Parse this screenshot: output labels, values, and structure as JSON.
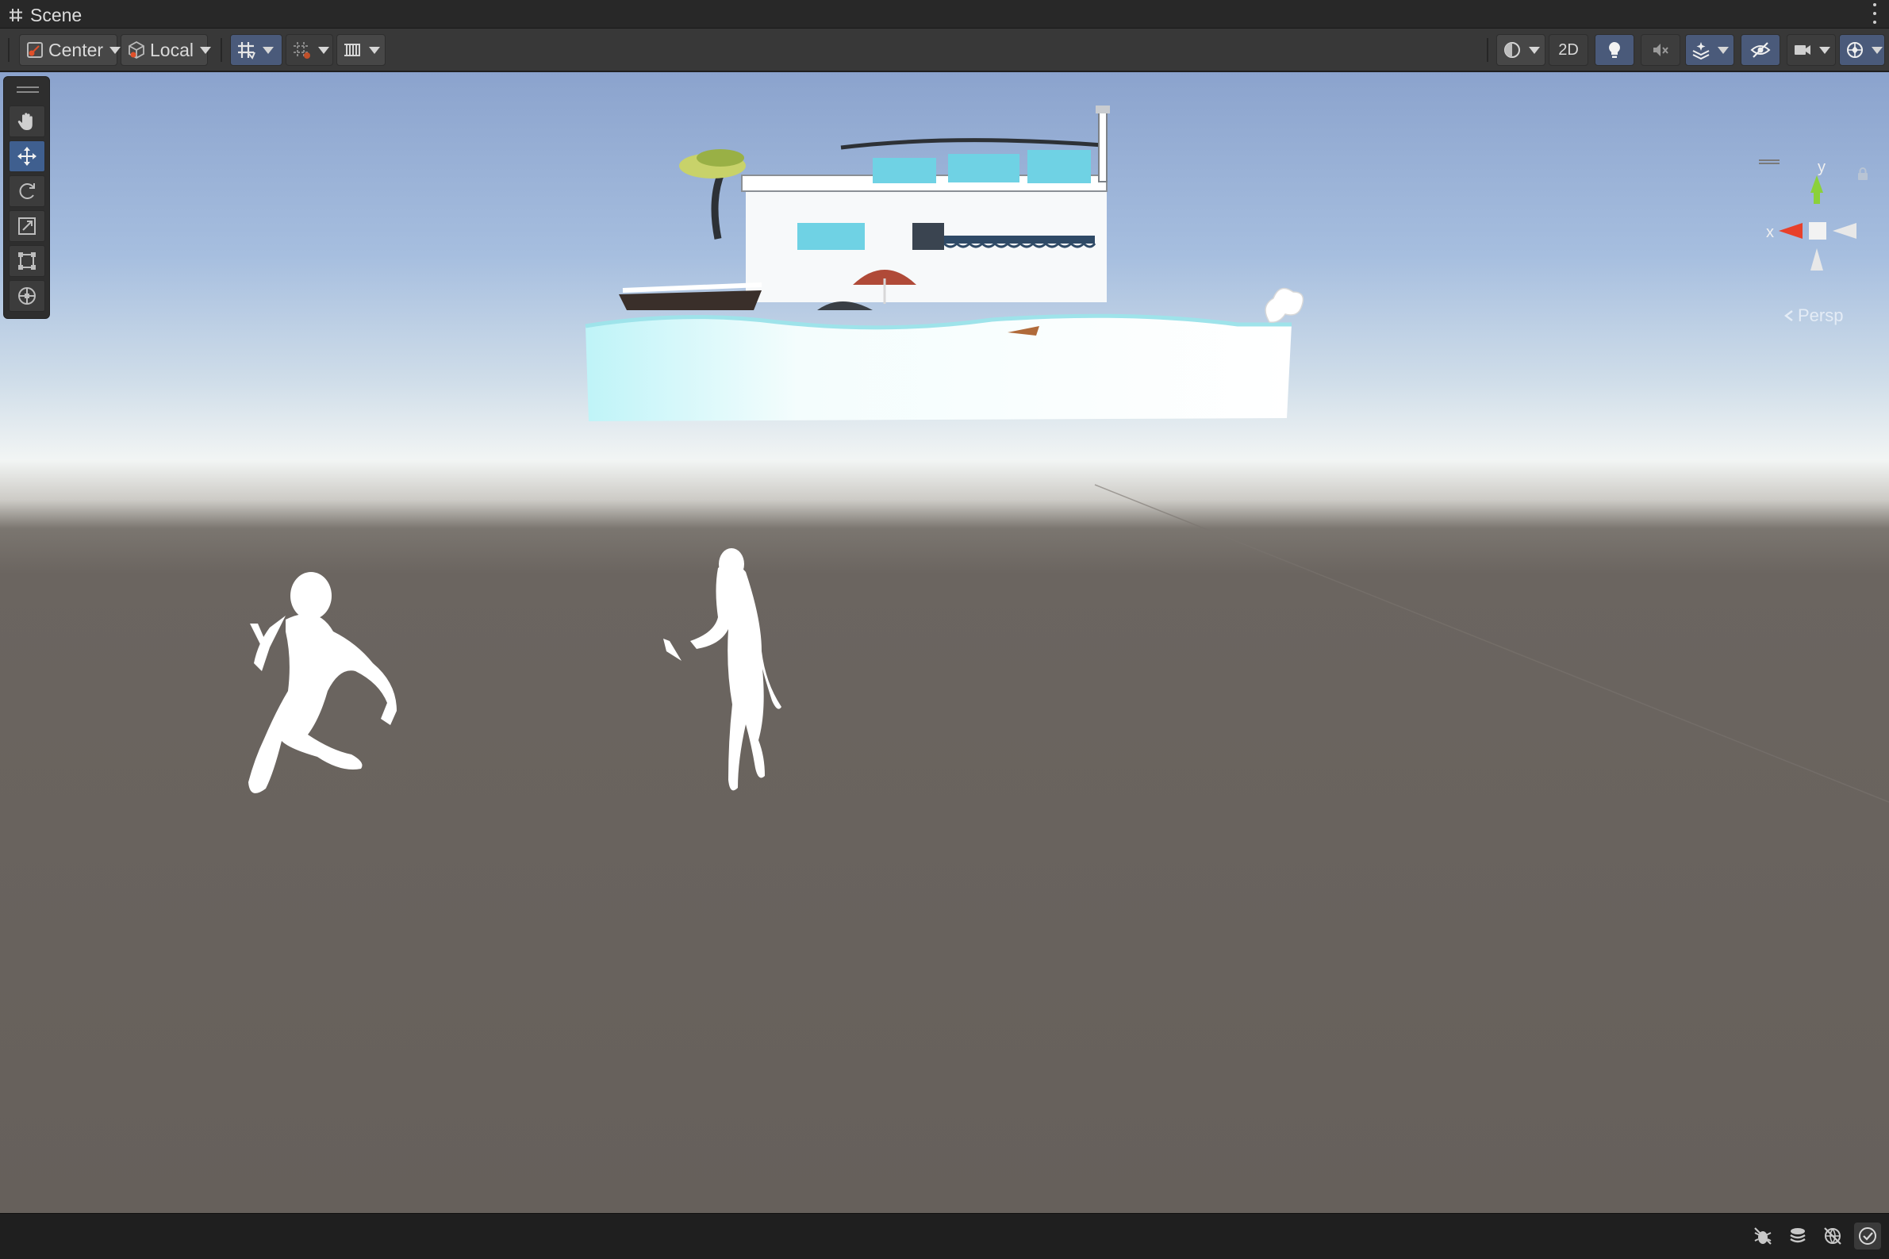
{
  "window": {
    "tab_title": "Scene",
    "tab_icon": "grid-hash-icon",
    "menu_icon": "kebab-menu-icon"
  },
  "toolbar": {
    "pivot_mode": "Center",
    "pivot_space": "Local",
    "view_2d_label": "2D",
    "left_group": [
      {
        "name": "pivot-mode-dropdown",
        "icon": "pivot-icon"
      },
      {
        "name": "pivot-space-dropdown",
        "icon": "local-cube-icon"
      },
      {
        "name": "grid-snap-toggle",
        "icon": "grid-snap-icon"
      },
      {
        "name": "increment-snap-toggle",
        "icon": "increment-snap-icon"
      },
      {
        "name": "vertex-snap-toggle",
        "icon": "ruler-grid-icon"
      }
    ],
    "right_group": [
      {
        "name": "draw-mode-dropdown",
        "icon": "shading-sphere-icon"
      },
      {
        "name": "2d-toggle",
        "icon": "2d-label"
      },
      {
        "name": "lighting-toggle",
        "icon": "lightbulb-icon"
      },
      {
        "name": "audio-toggle",
        "icon": "speaker-muted-icon"
      },
      {
        "name": "effects-dropdown",
        "icon": "layers-sparkle-icon"
      },
      {
        "name": "hidden-objects-toggle",
        "icon": "eye-slash-icon"
      },
      {
        "name": "camera-dropdown",
        "icon": "camera-icon"
      },
      {
        "name": "gizmos-dropdown",
        "icon": "gizmo-globe-icon"
      }
    ]
  },
  "tools": [
    {
      "name": "view-tool",
      "icon": "hand-icon",
      "active": false
    },
    {
      "name": "move-tool",
      "icon": "move-arrows-icon",
      "active": true
    },
    {
      "name": "rotate-tool",
      "icon": "rotate-icon",
      "active": false
    },
    {
      "name": "scale-tool",
      "icon": "scale-icon",
      "active": false
    },
    {
      "name": "rect-tool",
      "icon": "rect-transform-icon",
      "active": false
    },
    {
      "name": "transform-tool",
      "icon": "transform-icon",
      "active": false
    }
  ],
  "gizmo": {
    "y_axis_label": "y",
    "x_axis_label": "x",
    "projection_label": "Persp",
    "colors": {
      "x": "#e8402a",
      "y": "#8bd13a",
      "center": "#e8e8e8"
    }
  },
  "scene_objects": [
    {
      "name": "floating-house-island",
      "description_icon": "building-icon"
    },
    {
      "name": "character-male",
      "description_icon": "humanoid-icon"
    },
    {
      "name": "character-female",
      "description_icon": "humanoid-icon"
    }
  ],
  "status_icons": [
    {
      "name": "debug-overlay-toggle",
      "icon": "bug-slash-icon",
      "on": false
    },
    {
      "name": "layers-overlay-toggle",
      "icon": "stack-icon",
      "on": false
    },
    {
      "name": "scene-visibility-toggle",
      "icon": "globe-slash-icon",
      "on": false
    },
    {
      "name": "overlay-check-toggle",
      "icon": "check-circle-icon",
      "on": true
    }
  ]
}
